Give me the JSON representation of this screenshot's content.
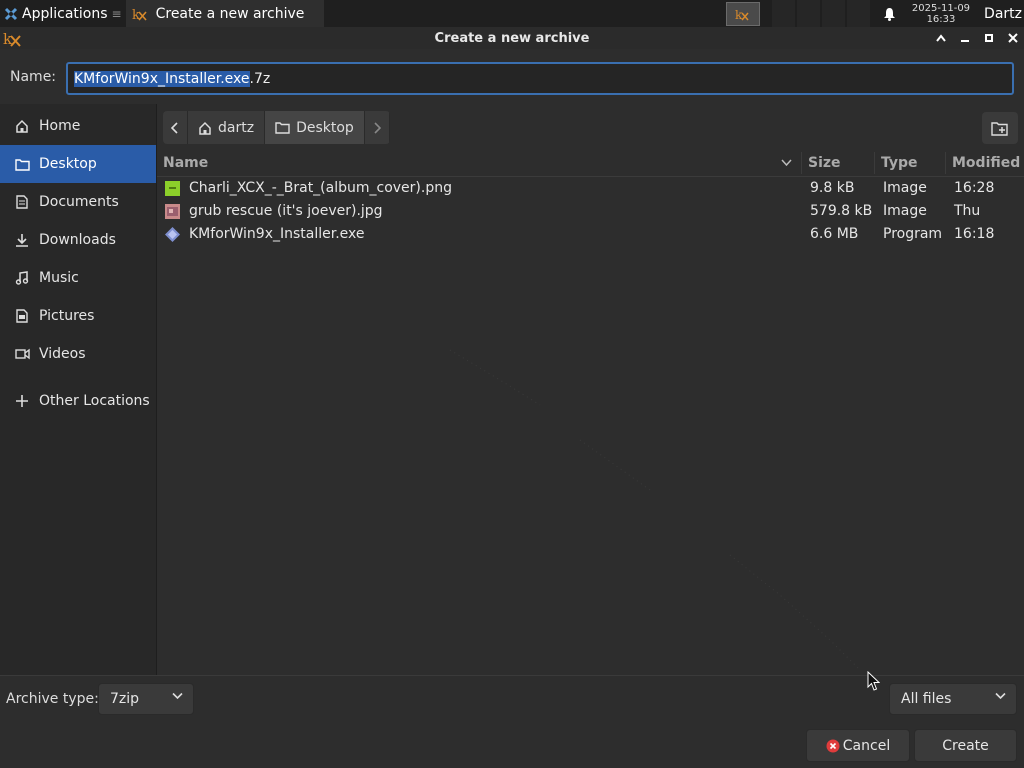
{
  "panel": {
    "apps_label": "Applications",
    "apps_sep": "≡",
    "task_title": "Create a new archive",
    "clock_date": "2025-11-09",
    "clock_time": "16:33",
    "user": "Dartz"
  },
  "window": {
    "title": "Create a new archive"
  },
  "name_row": {
    "label": "Name:",
    "value_selected": "KMforWin9x_Installer.exe",
    "value_rest": ".7z"
  },
  "sidebar": {
    "items": [
      {
        "label": "Home",
        "icon": "home-icon"
      },
      {
        "label": "Desktop",
        "icon": "folder-icon",
        "active": true
      },
      {
        "label": "Documents",
        "icon": "document-icon"
      },
      {
        "label": "Downloads",
        "icon": "download-icon"
      },
      {
        "label": "Music",
        "icon": "music-icon"
      },
      {
        "label": "Pictures",
        "icon": "pictures-icon"
      },
      {
        "label": "Videos",
        "icon": "video-icon"
      },
      {
        "label": "Other Locations",
        "icon": "plus-icon"
      }
    ]
  },
  "pathbar": {
    "crumbs": [
      "dartz",
      "Desktop"
    ]
  },
  "filelist": {
    "columns": [
      "Name",
      "Size",
      "Type",
      "Modified"
    ],
    "rows": [
      {
        "name": "Charli_XCX_-_Brat_(album_cover).png",
        "size": "9.8 kB",
        "type": "Image",
        "modified": "16:28",
        "icon": "image-green-icon"
      },
      {
        "name": "grub rescue (it's joever).jpg",
        "size": "579.8 kB",
        "type": "Image",
        "modified": "Thu",
        "icon": "image-photo-icon"
      },
      {
        "name": "KMforWin9x_Installer.exe",
        "size": "6.6 MB",
        "type": "Program",
        "modified": "16:18",
        "icon": "program-icon"
      }
    ]
  },
  "bottom": {
    "archive_type_label": "Archive type:",
    "archive_type_value": "7zip",
    "filter_value": "All files",
    "cancel_label": "Cancel",
    "create_label": "Create"
  },
  "colors": {
    "accent": "#2a5ca8",
    "background": "#2d2d2d",
    "sidebar_bg": "#282828",
    "panel_bg": "#1f1f1f"
  }
}
